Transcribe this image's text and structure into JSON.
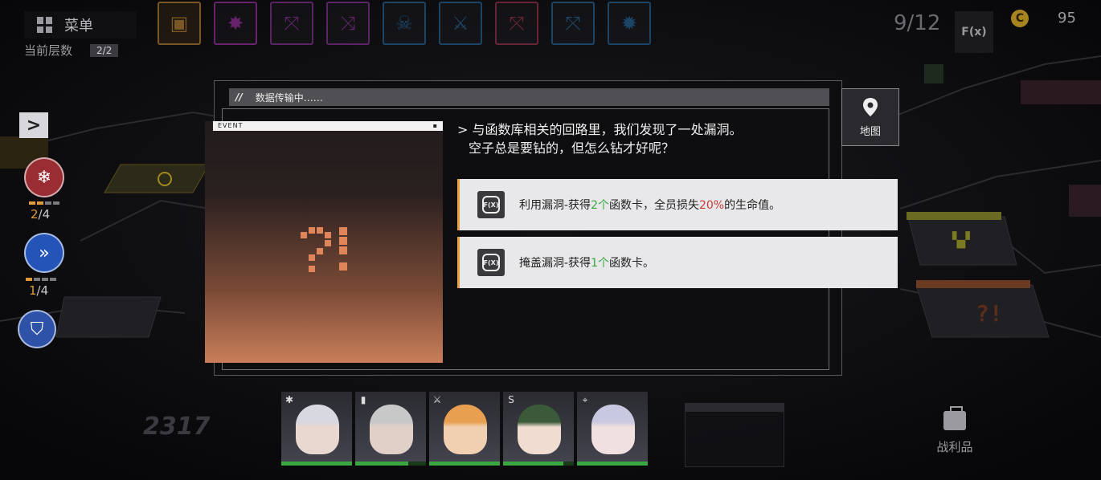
{
  "menu": {
    "label": "菜单"
  },
  "floor": {
    "label": "当前层数",
    "value": "2/2"
  },
  "top_bar": {
    "buffs": [
      {
        "icon": "circuit-chip-icon",
        "color": "#e8a23a"
      },
      {
        "icon": "burst-star-icon",
        "color": "#c03ac8"
      },
      {
        "icon": "crossbow-icon",
        "color": "#a83ab8"
      },
      {
        "icon": "crossed-arrows-icon",
        "color": "#a83ab8"
      },
      {
        "icon": "skull-shield-icon",
        "color": "#2a7ab8"
      },
      {
        "icon": "blade-plus-icon",
        "color": "#2a7ab8"
      },
      {
        "icon": "crossbow-heart-icon",
        "color": "#c03a5a"
      },
      {
        "icon": "crossbow-heart-icon",
        "color": "#2a7ab8"
      },
      {
        "icon": "gear-lightning-icon",
        "color": "#2a7ab8"
      }
    ],
    "progress": "9/12",
    "fx_label": "F(x)",
    "coin_symbol": "C",
    "coins": "95"
  },
  "left_panel": {
    "expand_symbol": ">",
    "skills": [
      {
        "icon": "freeze-bomb-icon",
        "used": "2",
        "total": "/4",
        "color": "#9a2c33"
      },
      {
        "icon": "dash-arrow-icon",
        "used": "1",
        "total": "/4",
        "color": "#2554b8"
      },
      {
        "icon": "shield-icon",
        "color": "#2d52a8"
      }
    ]
  },
  "dialog": {
    "header": "数据传输中……",
    "event_label": "EVENT",
    "description_line1": "> 与函数库相关的回路里，我们发现了一处漏洞。",
    "description_line2": "空子总是要钻的，但怎么钻才好呢？",
    "options": [
      {
        "icon_text": "F(X)",
        "pre": "利用漏洞-获得",
        "num": "2个",
        "mid": "函数卡，全员损失",
        "pct": "20%",
        "post": "的生命值。"
      },
      {
        "icon_text": "F(X)",
        "pre": "掩盖漏洞-获得",
        "num": "1个",
        "post": "函数卡。"
      }
    ]
  },
  "map_button": {
    "label": "地图"
  },
  "bottom": {
    "score": "2317",
    "team": [
      {
        "class_icon": "✱",
        "hair": "#d8d8e0",
        "skin": "#e8d8d0",
        "hp": 1.0
      },
      {
        "class_icon": "▮",
        "hair": "#c8c8c8",
        "skin": "#e0d0c8",
        "hp": 0.75
      },
      {
        "class_icon": "⚔",
        "hair": "#e8a050",
        "skin": "#f0d0b0",
        "hp": 1.0
      },
      {
        "class_icon": "S",
        "hair": "#3a5a3a",
        "skin": "#f0dcd0",
        "hp": 0.85
      },
      {
        "class_icon": "⌖",
        "hair": "#c8c8e0",
        "skin": "#f0e0e0",
        "hp": 1.0
      }
    ],
    "loot_label": "战利品"
  },
  "colors": {
    "accent_orange": "#e8a23a",
    "good_green": "#3aa840",
    "bad_red": "#c83a3a"
  }
}
